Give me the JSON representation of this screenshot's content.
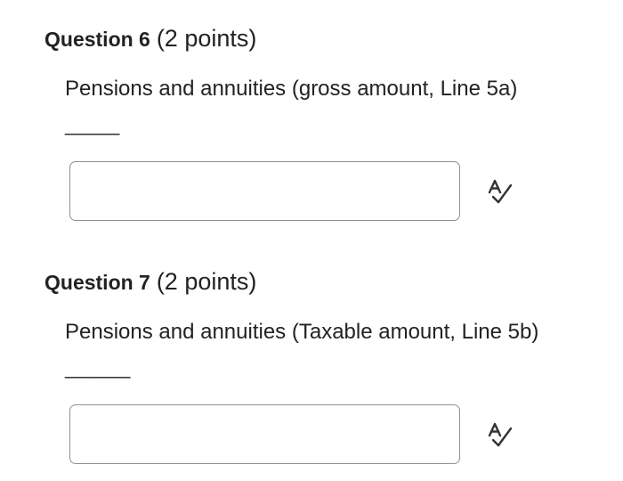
{
  "questions": [
    {
      "title": "Question 6",
      "points": "(2 points)",
      "prompt": "Pensions and annuities (gross amount, Line 5a)",
      "blank": "_____",
      "answer": {
        "value": "",
        "placeholder": ""
      },
      "spellcheck_icon": "spell-check-icon"
    },
    {
      "title": "Question 7",
      "points": "(2 points)",
      "prompt": "Pensions and annuities (Taxable amount, Line 5b)",
      "blank": "______",
      "answer": {
        "value": "",
        "placeholder": ""
      },
      "spellcheck_icon": "spell-check-icon"
    }
  ],
  "colors": {
    "text": "#222222",
    "input_border": "#8f8f8f",
    "icon": "#333333"
  }
}
